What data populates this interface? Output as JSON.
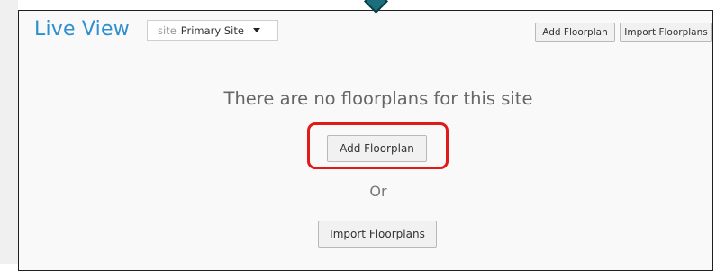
{
  "header": {
    "title": "Live View",
    "site_prefix": "site",
    "site_value": "Primary Site"
  },
  "toolbar": {
    "add_label": "Add Floorplan",
    "import_label": "Import Floorplans"
  },
  "empty_state": {
    "message": "There are no floorplans for this site",
    "add_label": "Add Floorplan",
    "or_label": "Or",
    "import_label": "Import Floorplans"
  },
  "colors": {
    "title": "#2d8fd0",
    "highlight": "#e01919",
    "pointer": "#1b6f7c"
  }
}
